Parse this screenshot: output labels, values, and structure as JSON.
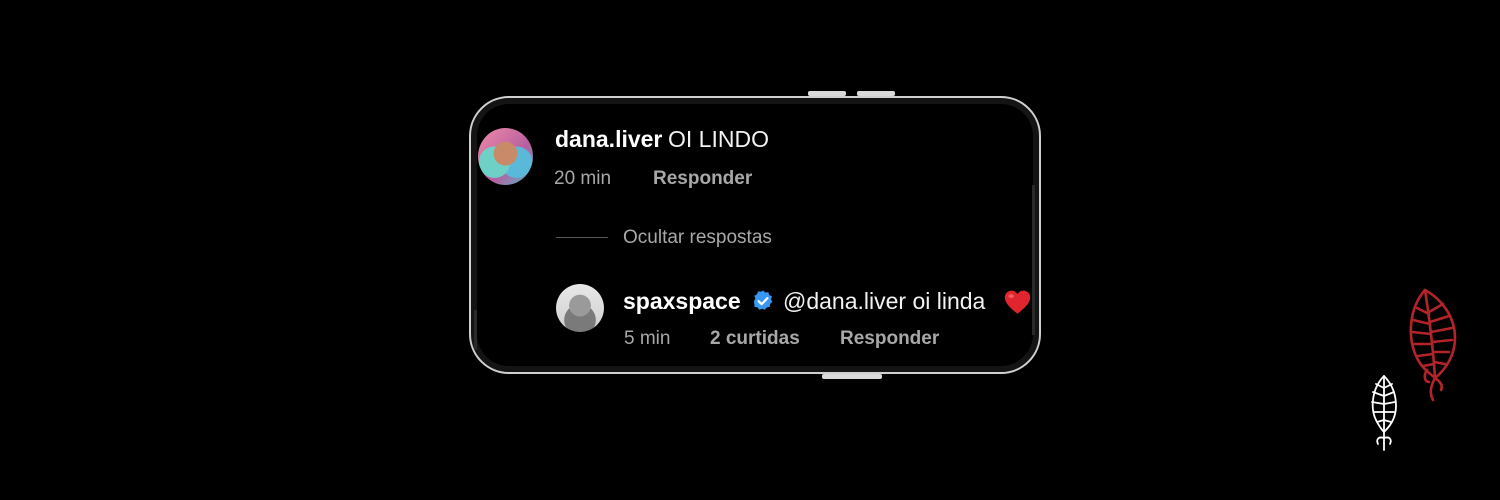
{
  "comment": {
    "username": "dana.liver",
    "text": "OI LINDO",
    "time": "20 min",
    "reply_label": "Responder"
  },
  "replies_toggle": {
    "label": "Ocultar respostas"
  },
  "reply": {
    "username": "spaxspace",
    "verified": true,
    "text": "@dana.liver oi linda",
    "emoji": "red-heart",
    "time": "5 min",
    "likes_label": "2 curtidas",
    "reply_label": "Responder"
  },
  "colors": {
    "background": "#000000",
    "verified_badge": "#3897f0",
    "heart": "#e0252f",
    "leaf_red": "#b3242a",
    "muted_text": "#a8a8a8"
  },
  "icons": {
    "verified": "verified-badge-icon",
    "heart": "heart-icon",
    "decor_red": "red-leaf-icon",
    "decor_white": "white-leaf-icon"
  }
}
